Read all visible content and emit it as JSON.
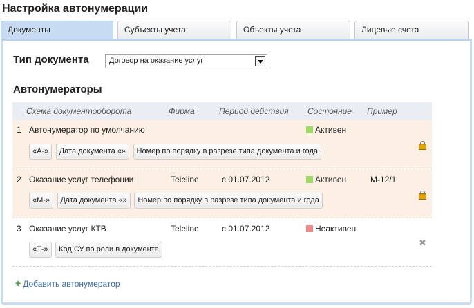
{
  "page_title": "Настройка автонумерации",
  "tabs": [
    {
      "label": "Документы",
      "active": true
    },
    {
      "label": "Субъекты учета",
      "active": false
    },
    {
      "label": "Объекты учета",
      "active": false
    },
    {
      "label": "Лицевые счета",
      "active": false
    }
  ],
  "doc_type": {
    "label": "Тип документа",
    "selected": "Договор на оказание услуг"
  },
  "section_title": "Автонумераторы",
  "table": {
    "headers": [
      "Схема документооборота",
      "Фирма",
      "Период действия",
      "Состояние",
      "Пример"
    ],
    "rows": [
      {
        "num": "1",
        "name": "Автонумератор по умолчанию",
        "firm": "",
        "period": "",
        "status": "Активен",
        "status_color": "#9fd86b",
        "example": "",
        "chips": [
          "«А-»",
          "Дата документа «»",
          "Номер по порядку в разрезе типа документа и года"
        ],
        "action_icon": "lock-icon"
      },
      {
        "num": "2",
        "name": "Оказание услуг телефонии",
        "firm": "Teleline",
        "period": "с 01.07.2012",
        "status": "Активен",
        "status_color": "#9fd86b",
        "example": "М-12/1",
        "chips": [
          "«М-»",
          "Дата документа «»",
          "Номер по порядку в разрезе типа документа и года"
        ],
        "action_icon": "lock-icon"
      },
      {
        "num": "3",
        "name": "Оказание услуг КТВ",
        "firm": "Teleline",
        "period": "с 01.07.2012",
        "status": "Неактивен",
        "status_color": "#f08a8a",
        "example": "",
        "chips": [
          "«Т-»",
          "Код СУ по роли в документе"
        ],
        "action_icon": "delete-icon"
      }
    ]
  },
  "add_link": "Добавить автонумератор",
  "colors": {
    "active_tab": "#c7dcf3",
    "highlight_row": "#fcefe3",
    "link": "#3b6ea5"
  }
}
